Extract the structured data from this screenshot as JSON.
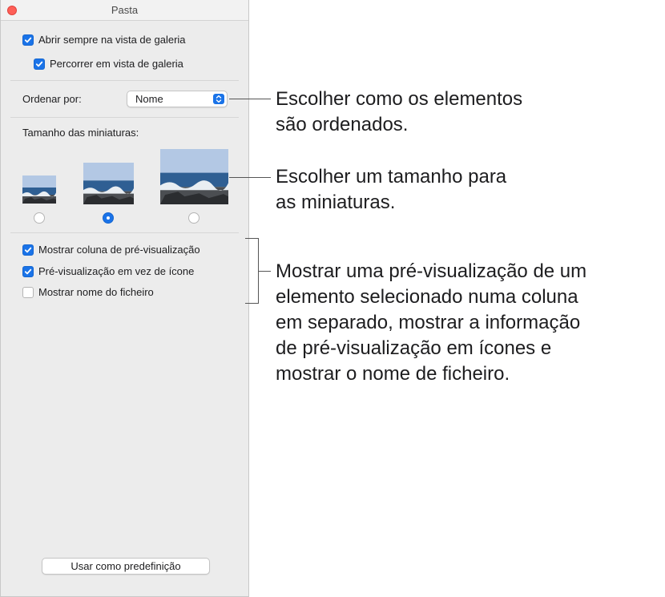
{
  "window": {
    "title": "Pasta",
    "options": {
      "open_gallery": {
        "label": "Abrir sempre na vista de galeria",
        "checked": true
      },
      "browse_gallery": {
        "label": "Percorrer em vista de galeria",
        "checked": true
      }
    },
    "sort": {
      "label": "Ordenar por:",
      "value": "Nome"
    },
    "thumb_size": {
      "label": "Tamanho das miniaturas:",
      "selected": "medium"
    },
    "preview": {
      "show_preview_column": {
        "label": "Mostrar coluna de pré-visualização",
        "checked": true
      },
      "preview_instead_icon": {
        "label": "Pré-visualização em vez de ícone",
        "checked": true
      },
      "show_filename": {
        "label": "Mostrar nome do ficheiro",
        "checked": false
      }
    },
    "default_button": "Usar como predefinição"
  },
  "callouts": {
    "sort": [
      "Escolher como os elementos",
      "são ordenados."
    ],
    "thumbs": [
      "Escolher um tamanho para",
      "as miniaturas."
    ],
    "preview": [
      "Mostrar uma pré-visualização de um",
      "elemento selecionado numa coluna",
      "em separado, mostrar a informação",
      "de pré-visualização em ícones e",
      "mostrar o nome de ficheiro."
    ]
  },
  "colors": {
    "accent": "#1a73e8",
    "close": "#fe5f57"
  }
}
